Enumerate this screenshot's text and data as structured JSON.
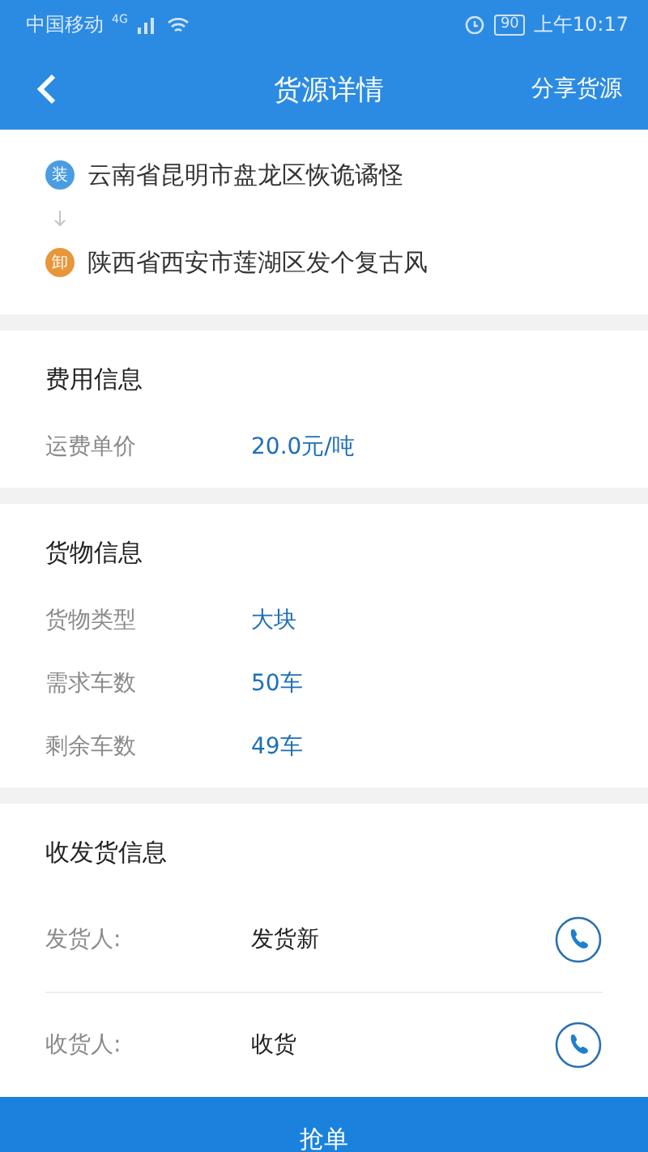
{
  "status_bar": {
    "carrier": "中国移动",
    "network": "4G",
    "battery": "90",
    "time": "上午10:17"
  },
  "header": {
    "title": "货源详情",
    "action": "分享货源"
  },
  "route": [
    {
      "badge": "装",
      "address": "云南省昆明市盘龙区恢诡谲怪",
      "color": "#4a9de0"
    },
    {
      "badge": "卸",
      "address": "陕西省西安市莲湖区发个复古风",
      "color": "#e8963a"
    }
  ],
  "sections": [
    {
      "title": "费用信息",
      "rows": [
        {
          "label": "运费单价",
          "value": "20.0元/吨"
        }
      ]
    },
    {
      "title": "货物信息",
      "rows": [
        {
          "label": "货物类型",
          "value": "大块"
        },
        {
          "label": "需求车数",
          "value": "50车"
        },
        {
          "label": "剩余车数",
          "value": "49车"
        }
      ]
    }
  ],
  "contacts": {
    "title": "收发货信息",
    "rows": [
      {
        "label": "发货人:",
        "name": "发货新"
      },
      {
        "label": "收货人:",
        "name": "收货"
      }
    ]
  },
  "bottom_button": "抢单"
}
